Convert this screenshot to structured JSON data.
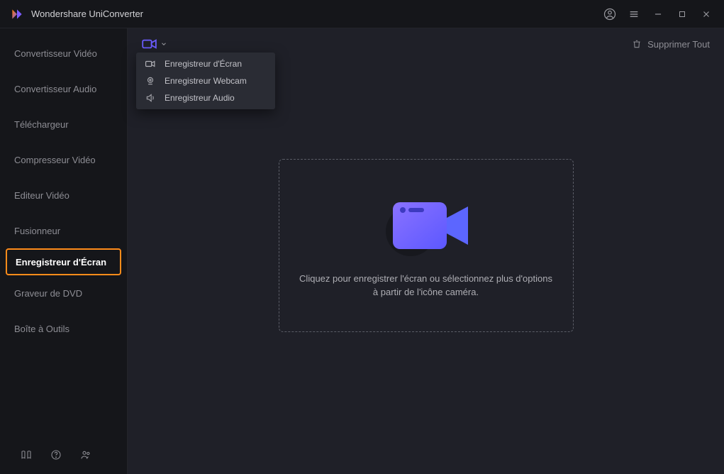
{
  "app": {
    "title": "Wondershare UniConverter"
  },
  "sidebar": {
    "items": [
      {
        "label": "Convertisseur Vidéo"
      },
      {
        "label": "Convertisseur Audio"
      },
      {
        "label": "Téléchargeur"
      },
      {
        "label": "Compresseur Vidéo"
      },
      {
        "label": "Editeur Vidéo"
      },
      {
        "label": "Fusionneur"
      },
      {
        "label": "Enregistreur d'Écran"
      },
      {
        "label": "Graveur de DVD"
      },
      {
        "label": "Boîte à Outils"
      }
    ]
  },
  "toolbar": {
    "clear_label": "Supprimer Tout"
  },
  "dropdown": {
    "items": [
      {
        "label": "Enregistreur d'Écran",
        "icon": "camera"
      },
      {
        "label": "Enregistreur Webcam",
        "icon": "webcam"
      },
      {
        "label": "Enregistreur Audio",
        "icon": "audio"
      }
    ]
  },
  "dropzone": {
    "hint": "Cliquez pour enregistrer l'écran ou sélectionnez plus d'options à partir de l'icône caméra."
  },
  "colors": {
    "accent_purple": "#6b5cff",
    "accent_blue": "#5c7bff",
    "highlight_orange": "#ff8c1a"
  }
}
